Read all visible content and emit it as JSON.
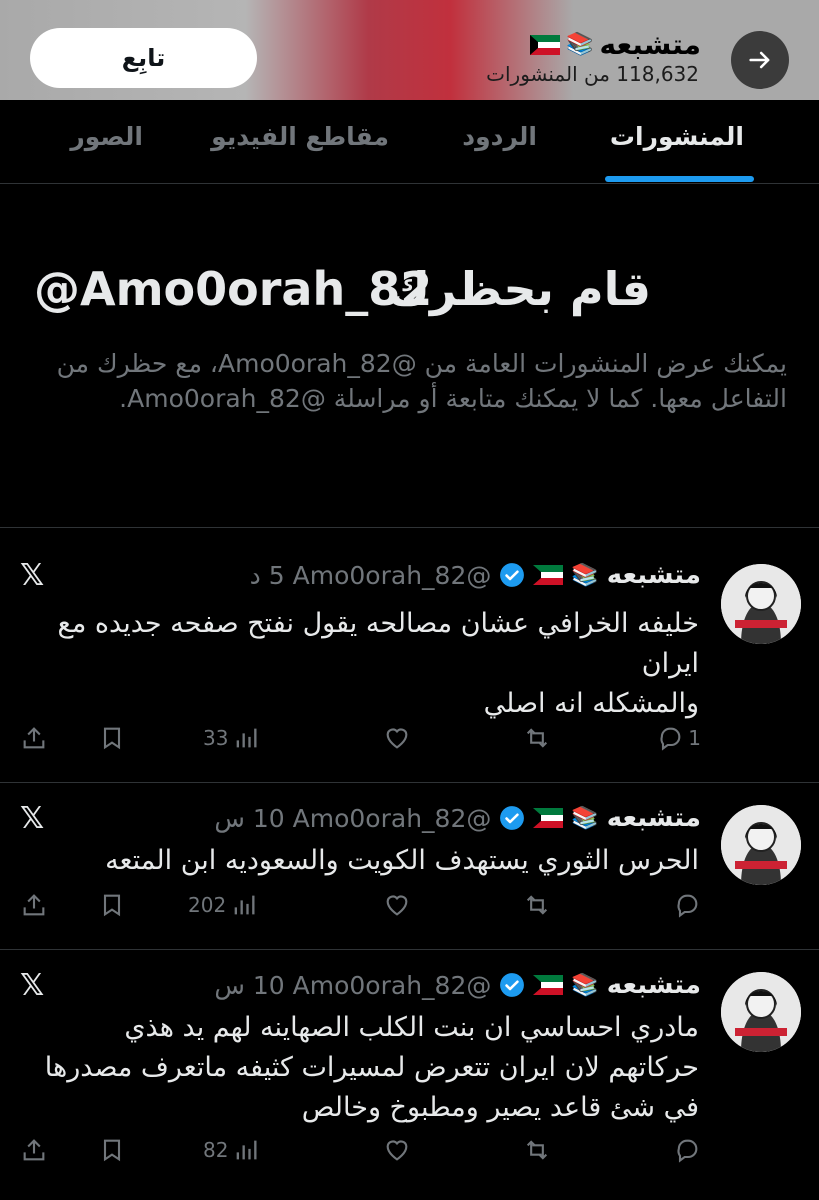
{
  "header": {
    "name": "متشبعه",
    "emoji": "📚",
    "post_count": "118,632 من المنشورات",
    "follow_label": "تابِع"
  },
  "tabs": [
    {
      "label": "المنشورات",
      "active": true
    },
    {
      "label": "الردود",
      "active": false
    },
    {
      "label": "مقاطع الفيديو",
      "active": false
    },
    {
      "label": "الصور",
      "active": false
    }
  ],
  "blocked": {
    "title": "قام بحظرك",
    "handle": "@Amo0orah_82",
    "description": "يمكنك عرض المنشورات العامة من @Amo0orah_82، مع حظرك من التفاعل معها. كما لا يمكنك متابعة أو مراسلة @Amo0orah_82."
  },
  "tweets": [
    {
      "name": "متشبعه",
      "handle": "@Amo0orah_82",
      "time": "5 د",
      "lines": [
        "خليفه الخرافي عشان مصالحه يقول نفتح صفحه جديده مع",
        "ايران",
        "والمشكله انه اصلي"
      ],
      "replies": "1",
      "retweets": "",
      "likes": "",
      "views": "33"
    },
    {
      "name": "متشبعه",
      "handle": "@Amo0orah_82",
      "time": "10 س",
      "lines": [
        "الحرس الثوري يستهدف الكويت والسعوديه ابن المتعه"
      ],
      "replies": "",
      "retweets": "",
      "likes": "",
      "views": "202"
    },
    {
      "name": "متشبعه",
      "handle": "@Amo0orah_82",
      "time": "10 س",
      "lines": [
        "مادري احساسي ان بنت الكلب الصهاينه لهم يد هذي",
        "حركاتهم لان ايران تتعرض لمسيرات كثيفه ماتعرف مصدرها",
        "في شئ قاعد يصير ومطبوخ وخالص"
      ],
      "replies": "",
      "retweets": "",
      "likes": "",
      "views": "82"
    }
  ],
  "colors": {
    "accent": "#1d9bf0",
    "muted": "#71767b",
    "text": "#e7e9ea",
    "background": "#000000"
  }
}
